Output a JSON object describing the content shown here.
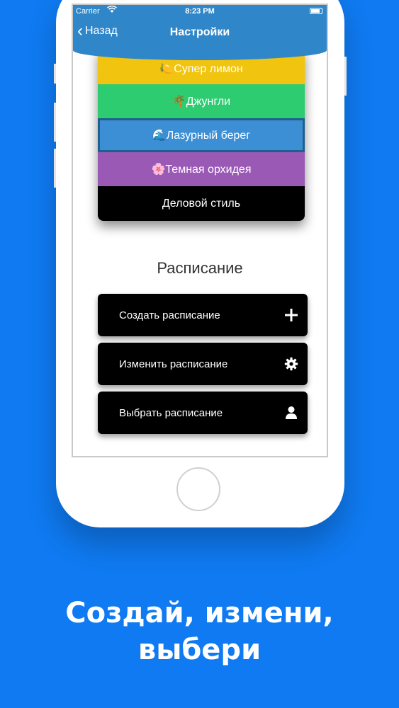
{
  "status_bar": {
    "carrier": "Carrier",
    "time": "8:23 PM"
  },
  "nav": {
    "back_label": "Назад",
    "title": "Настройки"
  },
  "themes": [
    {
      "label": "🍋Супер лимон",
      "color": "#f1c40f"
    },
    {
      "label": "🌴Джунгли",
      "color": "#2ecc71"
    },
    {
      "label": "🌊Лазурный берег",
      "color": "#3c8fd4"
    },
    {
      "label": "🌸Темная орхидея",
      "color": "#9b59b6"
    },
    {
      "label": "Деловой стиль",
      "color": "#000000"
    }
  ],
  "schedule": {
    "title": "Расписание",
    "buttons": [
      {
        "label": "Создать расписание",
        "icon": "plus-icon"
      },
      {
        "label": "Изменить расписание",
        "icon": "gear-icon"
      },
      {
        "label": "Выбрать расписание",
        "icon": "user-icon"
      }
    ]
  },
  "caption": {
    "line1": "Создай, измени,",
    "line2": "выбери"
  },
  "colors": {
    "background": "#0f7af1",
    "navbar": "#2f86c9"
  }
}
